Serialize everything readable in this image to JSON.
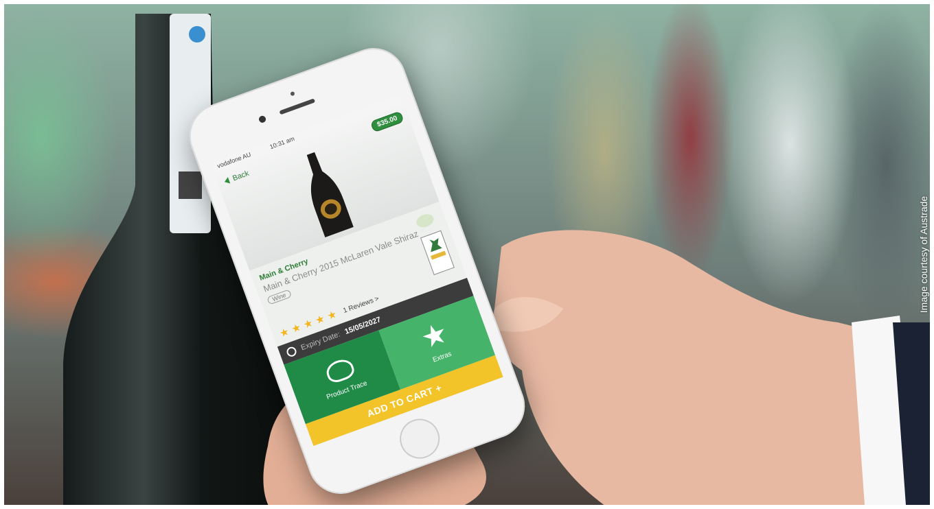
{
  "scene": {
    "credit": "Image courtesy of Austrade"
  },
  "app": {
    "status": {
      "carrier": "vodafone AU",
      "time": "10:31 am"
    },
    "price": "$35.00",
    "back_label": "Back",
    "product": {
      "brand": "Main & Cherry",
      "name": "Main & Cherry 2015 McLaren Vale Shiraz",
      "category": "Wine",
      "rating": 5,
      "reviews_label": "1 Reviews >"
    },
    "expiry": {
      "label": "Expiry Date:",
      "value": "15/05/2027"
    },
    "tiles": {
      "trace_label": "Product Trace",
      "extras_label": "Extras"
    },
    "cart_label": "ADD TO CART +"
  },
  "colors": {
    "brand_green": "#2f8f3f",
    "tile_dark": "#1f8b47",
    "tile_light": "#46b36a",
    "cart_yellow": "#f2c42a",
    "star": "#f2b51d"
  }
}
